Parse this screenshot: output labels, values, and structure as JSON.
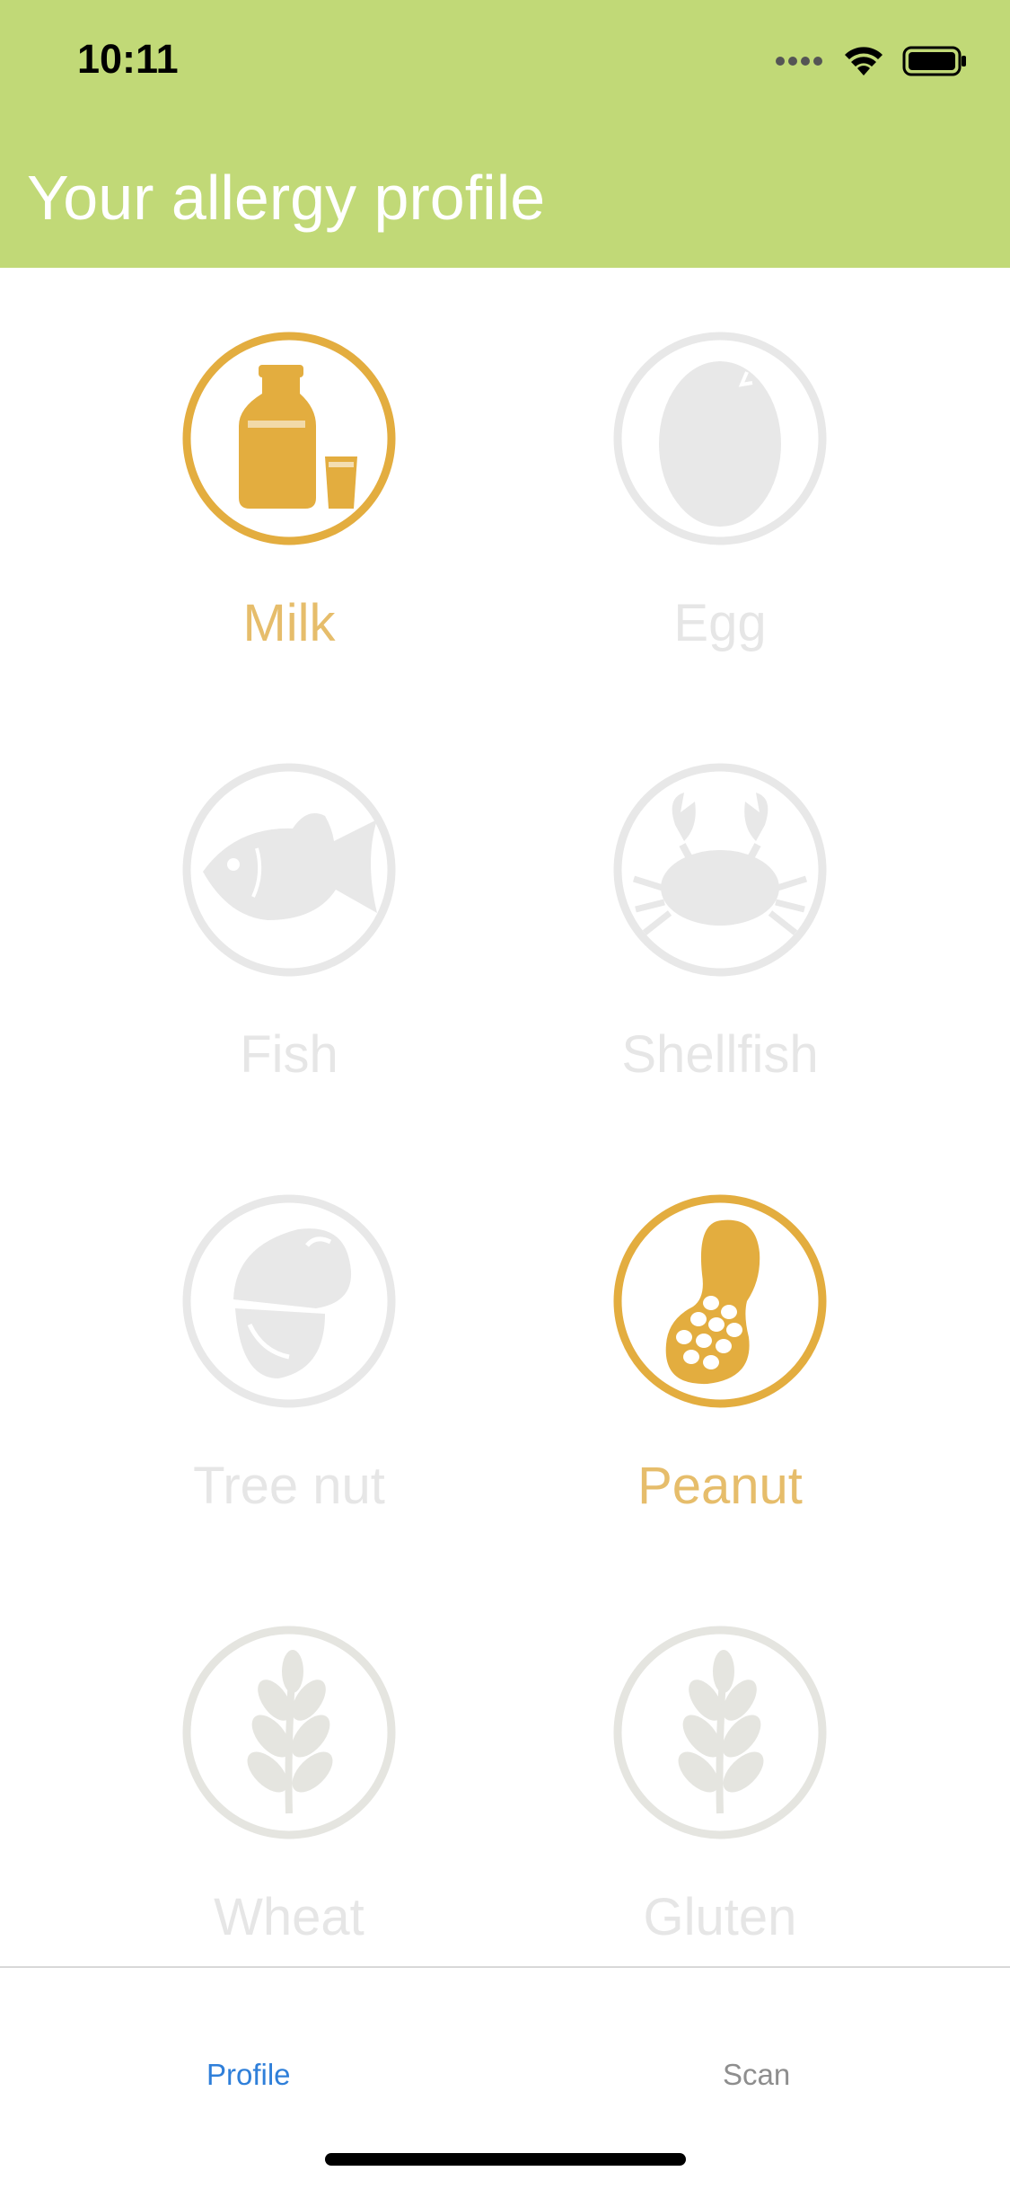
{
  "status_bar": {
    "time": "10:11",
    "icons": [
      "signal-dots-icon",
      "wifi-icon",
      "battery-icon"
    ]
  },
  "header": {
    "title": "Your allergy profile",
    "background_color": "#c1d977"
  },
  "colors": {
    "selected": "#e3ad3f",
    "selected_label": "#e6bd6b",
    "unselected": "#e8e8e8",
    "unselected_label": "#e6e6e6",
    "tab_active": "#2f7fd9",
    "tab_inactive": "#8e8e8e"
  },
  "allergens": [
    {
      "label": "Milk",
      "icon": "milk-bottle-icon",
      "selected": true
    },
    {
      "label": "Egg",
      "icon": "egg-icon",
      "selected": false
    },
    {
      "label": "Fish",
      "icon": "fish-icon",
      "selected": false
    },
    {
      "label": "Shellfish",
      "icon": "crab-icon",
      "selected": false
    },
    {
      "label": "Tree nut",
      "icon": "acorn-icon",
      "selected": false
    },
    {
      "label": "Peanut",
      "icon": "peanut-icon",
      "selected": true
    },
    {
      "label": "Wheat",
      "icon": "wheat-icon",
      "selected": false
    },
    {
      "label": "Gluten",
      "icon": "wheat-icon",
      "selected": false
    }
  ],
  "tabs": [
    {
      "label": "Profile",
      "active": true
    },
    {
      "label": "Scan",
      "active": false
    }
  ]
}
